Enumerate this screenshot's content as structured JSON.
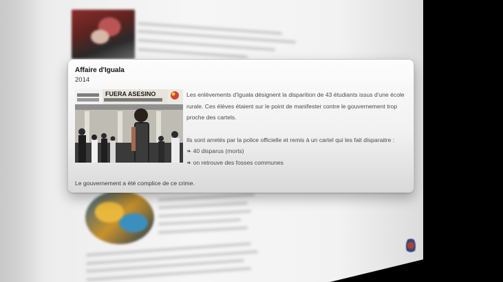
{
  "card": {
    "title": "Affaire d'Iguala",
    "year": "2014",
    "photo_banner": "FUERA ASESINO",
    "body": [
      "Les enlèvements d'Iguala désignent la disparition de 43 étudiants issus d'une école rurale. Ces élèves étaient sur le point de manifester contre le gouvernement trop proche des cartels.",
      "Ils sont arretés par la police officielle et remis à un cartel qui les fait disparaitre :"
    ],
    "bullets": [
      "❧ 40 disparus (morts)",
      "❧ on retrouve des fosses communes"
    ],
    "footer": "Le gouvernement a été complice de ce crime."
  },
  "colors": {
    "card_background": "#f5f5f5",
    "text": "#4a4a4a",
    "title": "#111111",
    "backdrop": "#000000"
  }
}
